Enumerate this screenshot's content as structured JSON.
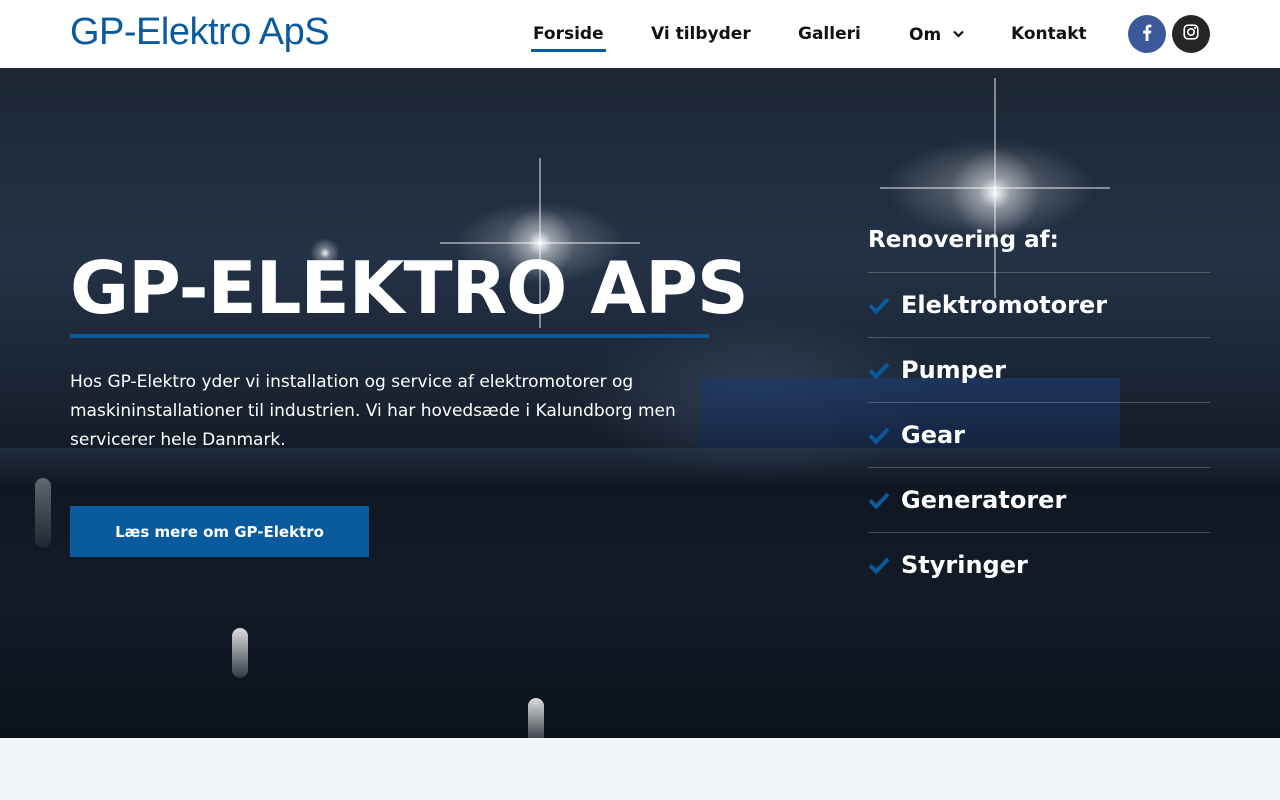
{
  "brand": {
    "logo_text": "GP-Elektro ApS",
    "accent_color": "#0a5a9e"
  },
  "nav": {
    "items": [
      {
        "label": "Forside",
        "active": true
      },
      {
        "label": "Vi tilbyder",
        "active": false
      },
      {
        "label": "Galleri",
        "active": false
      },
      {
        "label": "Om",
        "active": false,
        "has_dropdown": true
      },
      {
        "label": "Kontakt",
        "active": false
      }
    ],
    "social": [
      {
        "icon": "facebook-icon",
        "color": "#3b5998"
      },
      {
        "icon": "instagram-icon",
        "color": "#262626"
      }
    ]
  },
  "hero": {
    "title": "GP-ELEKTRO APS",
    "text": "Hos GP-Elektro yder vi installation og service af elektromotorer og maskininstallationer til industrien. Vi har hovedsæde i Kalundborg men servicerer hele Danmark.",
    "cta_label": "Læs mere om GP-Elektro"
  },
  "services": {
    "title": "Renovering af:",
    "items": [
      {
        "label": "Elektromotorer",
        "icon": "check-icon"
      },
      {
        "label": "Pumper",
        "icon": "check-icon"
      },
      {
        "label": "Gear",
        "icon": "check-icon"
      },
      {
        "label": "Generatorer",
        "icon": "check-icon"
      },
      {
        "label": "Styringer",
        "icon": "check-icon"
      }
    ]
  }
}
